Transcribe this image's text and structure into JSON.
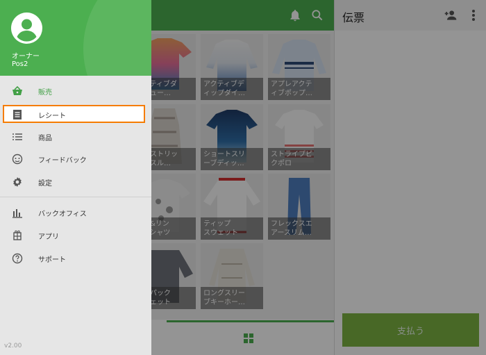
{
  "drawer": {
    "user_name": "オーナー",
    "store_name": "Pos2",
    "version": "v2.00",
    "items": [
      {
        "label": "販売",
        "icon": "basket-icon"
      },
      {
        "label": "レシート",
        "icon": "receipt-icon"
      },
      {
        "label": "商品",
        "icon": "list-icon"
      },
      {
        "label": "フィードバック",
        "icon": "feedback-icon"
      },
      {
        "label": "設定",
        "icon": "gear-icon"
      },
      {
        "label": "バックオフィス",
        "icon": "bar-chart-icon"
      },
      {
        "label": "アプリ",
        "icon": "puzzle-icon"
      },
      {
        "label": "サポート",
        "icon": "help-icon"
      }
    ]
  },
  "products": [
    {
      "name": "アクティブダ\nクリュー…"
    },
    {
      "name": "アクティブデ\nィップダイ…"
    },
    {
      "name": "アプレアクテ\nィブポップ…"
    },
    {
      "name": "イドストリッ\nマッスル…"
    },
    {
      "name": "ショートスリ\nーブディッ…"
    },
    {
      "name": "ストライプピ\nクポロ"
    },
    {
      "name": "フト&リン\nー Tシャツ"
    },
    {
      "name": "ティップ\nスウェット"
    },
    {
      "name": "フレックスエ\nアースリム…"
    },
    {
      "name": "ダーパック\nスウェット"
    },
    {
      "name": "ロングスリー\nブキーホー…"
    }
  ],
  "receipt": {
    "title": "伝票",
    "pay_label": "支払う"
  },
  "colors": {
    "brand_green": "#4caf50",
    "highlight": "#f57c00",
    "pay_green": "#7cb342"
  }
}
